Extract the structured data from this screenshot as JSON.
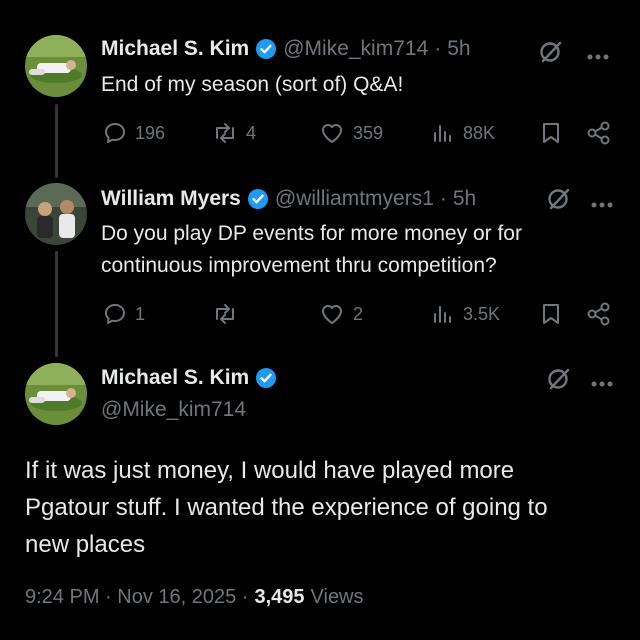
{
  "tweet1": {
    "name": "Michael S. Kim",
    "handle": "@Mike_kim714",
    "sep": "·",
    "time": "5h",
    "text": "End of my season (sort of) Q&A!",
    "replies": "196",
    "reposts": "4",
    "likes": "359",
    "views": "88K"
  },
  "tweet2": {
    "name": "William Myers",
    "handle": "@williamtmyers1",
    "sep": "·",
    "time": "5h",
    "text_line1": "Do you play DP events for more money or for",
    "text_line2": "continuous improvement thru competition?",
    "replies": "1",
    "reposts": "",
    "likes": "2",
    "views": "3.5K"
  },
  "main": {
    "name": "Michael S. Kim",
    "handle": "@Mike_kim714",
    "text_line1": "If it was just money, I would have played more",
    "text_line2": "Pgatour stuff. I wanted the experience of going to",
    "text_line3": "new places",
    "timestamp": "9:24 PM · Nov 16, 2025 ·",
    "view_count": "3,495",
    "views_label": "Views"
  },
  "colors": {
    "background": "#000000",
    "text": "#e7e9ea",
    "muted": "#71767b",
    "verified": "#1d9bf0"
  },
  "icons": [
    "verified-badge-icon",
    "grok-icon",
    "more-icon",
    "reply-icon",
    "repost-icon",
    "like-icon",
    "views-icon",
    "bookmark-icon",
    "share-icon"
  ]
}
